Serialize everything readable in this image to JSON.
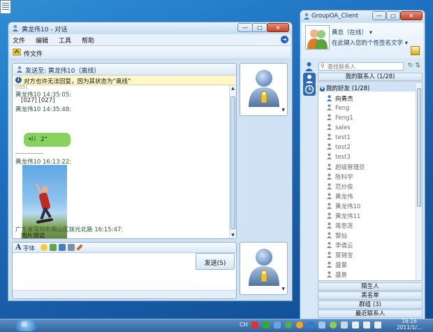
{
  "chat_window": {
    "title": "黄龙伟10 - 对话",
    "menu": [
      "文件",
      "编辑",
      "工具",
      "帮助"
    ],
    "toolbar_label": "传文件",
    "send_to_label": "发送至: 黄龙伟10（离线）",
    "notice": "对方也许无法回复，因为其状态为“离线”",
    "messages": {
      "top_cut": "[0]5]",
      "m1_head": "黄龙伟10 14:35:05:",
      "m1_body": "[027] [027]",
      "m2_head": "黄龙伟10 14:35:48:",
      "voice_len": "2\"",
      "m3_head": "黄龙伟10 16:13:22:",
      "m4_head": "广东省深圳市南山区抹光北路 16:15:47:",
      "m4_body": "图片测试"
    },
    "format_label": "字体",
    "send_button": "发送(S)",
    "window_controls": {
      "minimize": "—",
      "maximize": "□",
      "close": "×"
    }
  },
  "contacts_window": {
    "title": "GroupOA_Client",
    "profile": {
      "name": "黄总（在线）",
      "signature": "在此键入您的个性签名文字"
    },
    "search_placeholder": "查找联系人",
    "my_contacts": "我的联系人 (1/28)",
    "friends_group": "我的好友 (1/28)",
    "contacts": [
      {
        "name": "向勇杰",
        "online": true
      },
      {
        "name": "Feng",
        "online": false
      },
      {
        "name": "Feng1",
        "online": false
      },
      {
        "name": "sales",
        "online": false
      },
      {
        "name": "test1",
        "online": false
      },
      {
        "name": "test2",
        "online": false
      },
      {
        "name": "test3",
        "online": false
      },
      {
        "name": "超级管理员",
        "online": false
      },
      {
        "name": "陈科宇",
        "online": false
      },
      {
        "name": "范炒俊",
        "online": false
      },
      {
        "name": "黄龙伟",
        "online": false
      },
      {
        "name": "黄龙伟10",
        "online": false
      },
      {
        "name": "黄龙伟11",
        "online": false
      },
      {
        "name": "蒋思莲",
        "online": false
      },
      {
        "name": "黎灿",
        "online": false
      },
      {
        "name": "李倩云",
        "online": false
      },
      {
        "name": "莫锦宝",
        "online": false
      },
      {
        "name": "盛葉",
        "online": false
      },
      {
        "name": "盛景",
        "online": false
      }
    ],
    "bottom_groups": [
      "陌生人",
      "黑名单",
      "群组 (3)",
      "最近联系人"
    ]
  },
  "taskbar": {
    "tray_text": "CH",
    "time": "16:16",
    "date": "2011/1/..."
  },
  "colors": {
    "desktop": "#1d6fbf",
    "voice_bubble": "#88d35f",
    "notice_bg": "#fff7c8",
    "group_selected": "#cfe2f7"
  }
}
